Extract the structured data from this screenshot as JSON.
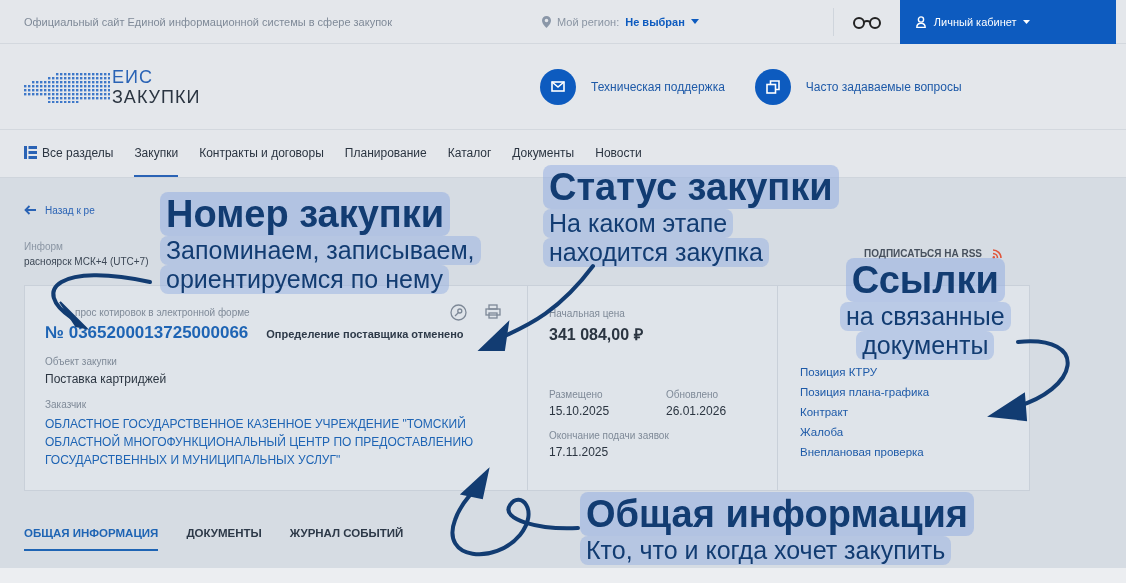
{
  "top_bar": {
    "site_title": "Официальный сайт Единой информационной системы в сфере закупок",
    "region_label": "Мой регион:",
    "region_value": "Не выбран",
    "account_button": "Личный кабинет"
  },
  "header": {
    "logo_top": "ЕИС",
    "logo_bottom": "ЗАКУПКИ",
    "links": [
      {
        "label": "Техническая поддержка",
        "kind": "mail"
      },
      {
        "label": "Часто задаваемые вопросы",
        "kind": "copy"
      }
    ]
  },
  "nav": [
    {
      "label": "Все разделы",
      "kind": "sections",
      "selected": false
    },
    {
      "label": "Закупки",
      "kind": "plain",
      "selected": true
    },
    {
      "label": "Контракты и договоры",
      "kind": "plain",
      "selected": false
    },
    {
      "label": "Планирование",
      "kind": "plain",
      "selected": false
    },
    {
      "label": "Каталог",
      "kind": "plain",
      "selected": false
    },
    {
      "label": "Документы",
      "kind": "plain",
      "selected": false
    },
    {
      "label": "Новости",
      "kind": "plain",
      "selected": false
    }
  ],
  "breadcrumb": "Назад к ре",
  "info_line": "Информ",
  "timezone": "расноярск МСК+4 (UTC+7)",
  "rss": "ПОДПИСАТЬСЯ НА RSS",
  "purchase": {
    "type": "прос котировок в электронной форме",
    "number": "№ 0365200013725000066",
    "status": "Определение поставщика отменено",
    "fields": [
      {
        "label": "Объект закупки",
        "value": "Поставка картриджей",
        "kind": "text"
      },
      {
        "label": "Заказчик",
        "value": "ОБЛАСТНОЕ ГОСУДАРСТВЕННОЕ КАЗЕННОЕ УЧРЕЖДЕНИЕ \"ТОМСКИЙ ОБЛАСТНОЙ МНОГОФУНКЦИОНАЛЬНЫЙ ЦЕНТР ПО ПРЕДОСТАВЛЕНИЮ ГОСУДАРСТВЕННЫХ И МУНИЦИПАЛЬНЫХ УСЛУГ\"",
        "kind": "link"
      }
    ]
  },
  "price": {
    "label": "Начальная цена",
    "value": "341 084,00 ₽"
  },
  "dates": [
    {
      "label": "Размещено",
      "value": "15.10.2025"
    },
    {
      "label": "Обновлено",
      "value": "26.01.2026"
    },
    {
      "label": "Окончание подачи заявок",
      "value": "17.11.2025"
    }
  ],
  "links": [
    "Позиция КТРУ",
    "Позиция плана-графика",
    "Контракт",
    "Жалоба",
    "Внеплановая проверка"
  ],
  "tabs": [
    {
      "label": "ОБЩАЯ ИНФОРМАЦИЯ",
      "selected": true
    },
    {
      "label": "ДОКУМЕНТЫ",
      "selected": false
    },
    {
      "label": "ЖУРНАЛ СОБЫТИЙ",
      "selected": false
    }
  ],
  "annotations": [
    {
      "title": "Номер закупки",
      "lines": [
        "Запоминаем, записываем,",
        "ориентируемся по нему"
      ]
    },
    {
      "title": "Статус закупки",
      "lines": [
        "На каком этапе",
        "находится закупка"
      ]
    },
    {
      "title": "Ссылки",
      "lines": [
        "на связанные",
        "документы"
      ]
    },
    {
      "title": "Общая информация",
      "lines": [
        "Кто, что и когда хочет закупить"
      ]
    }
  ]
}
